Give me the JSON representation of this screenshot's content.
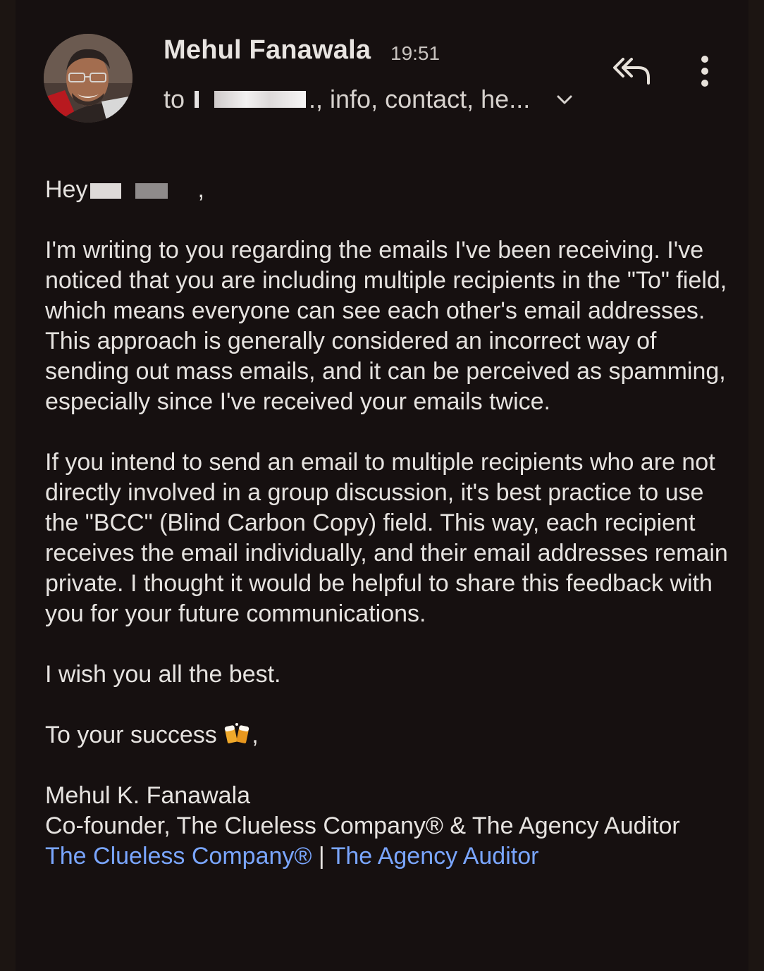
{
  "header": {
    "sender_name": "Mehul Fanawala",
    "time": "19:51",
    "to_prefix": "to",
    "to_suffix": "., info, contact, he...",
    "avatar_icon": "avatar-photo",
    "reply_all_icon": "reply-all-icon",
    "more_icon": "more-vert-icon",
    "expand_icon": "chevron-down-icon"
  },
  "body": {
    "greeting_prefix": "Hey",
    "greeting_suffix": ",",
    "paragraph_1": "I'm writing to you regarding the emails I've been receiving. I've noticed that you are including multiple recipients in the \"To\" field, which means everyone can see each other's email addresses. This approach is generally considered an incorrect way of sending out mass emails, and it can be perceived as spamming, especially since I've received your emails twice.",
    "paragraph_2": "If you intend to send an email to multiple recipients who are not directly involved in a group discussion, it's best practice to use the \"BCC\" (Blind Carbon Copy) field. This way, each recipient receives the email individually, and their email addresses remain private. I thought it would be helpful to share this feedback with you for your future communications.",
    "closing_1": "I wish you all the best.",
    "closing_2_text": "To your success",
    "closing_2_suffix": ",",
    "beer_icon": "clinking-beer-mugs-icon"
  },
  "signature": {
    "name": "Mehul K. Fanawala",
    "title": "Co-founder, The Clueless Company® & The Agency Auditor",
    "link_1": "The Clueless Company®",
    "separator": " | ",
    "link_2": "The Agency Auditor"
  },
  "colors": {
    "background": "#161010",
    "text": "#e6e3e0",
    "link": "#7aa6ff"
  }
}
